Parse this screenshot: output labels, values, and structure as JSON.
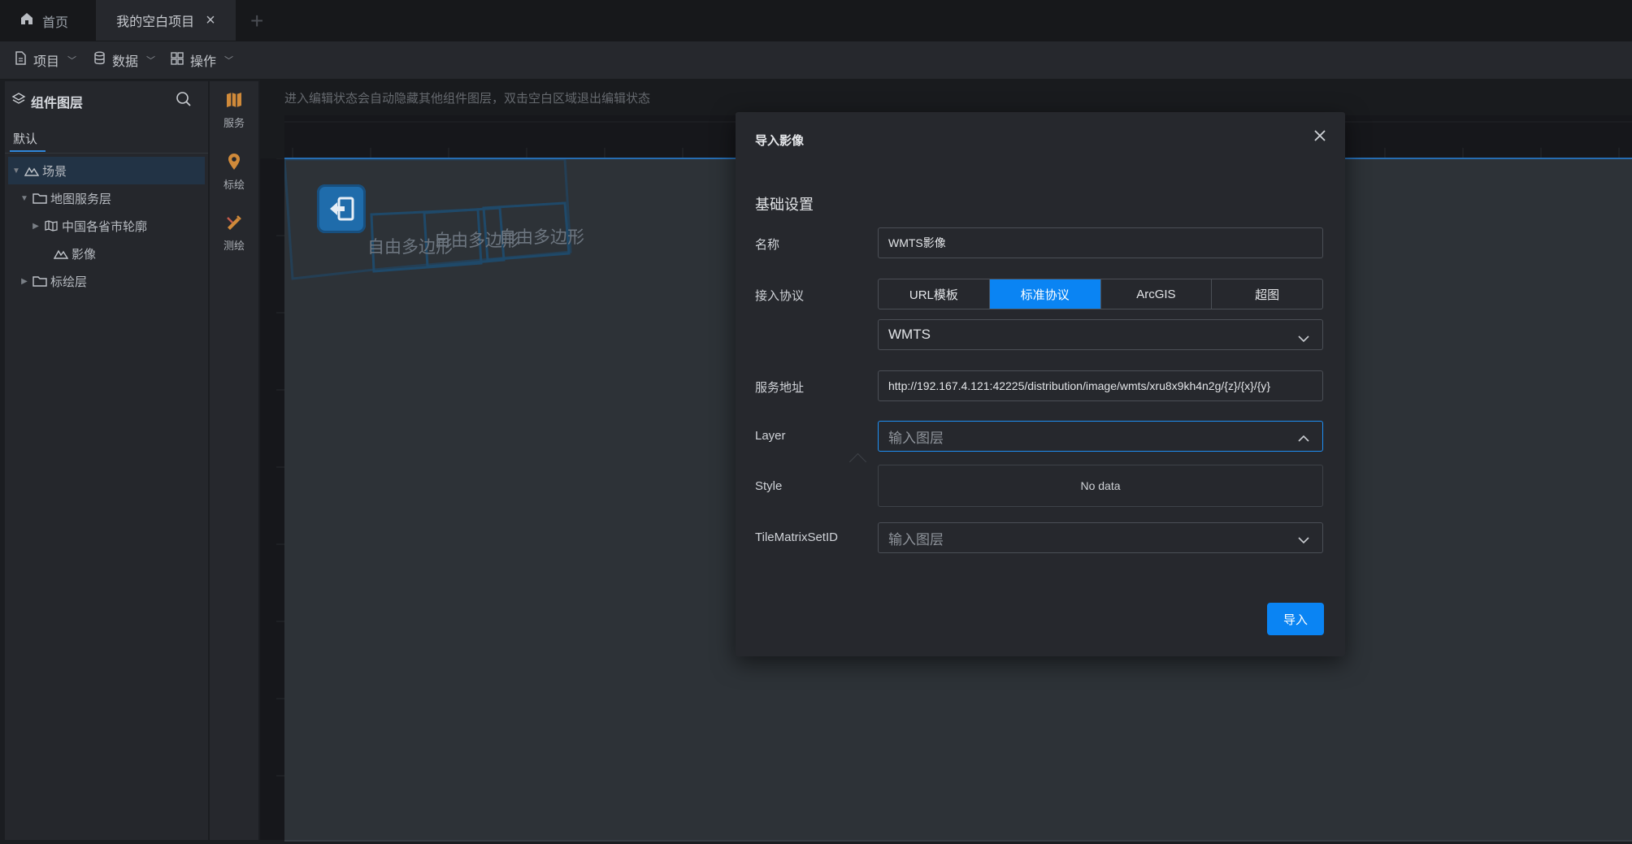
{
  "tabs": {
    "home_label": "首页",
    "project_label": "我的空白项目",
    "add_label": "+"
  },
  "menubar": {
    "project_label": "项目",
    "data_label": "数据",
    "operation_label": "操作"
  },
  "layer_panel": {
    "title": "组件图层",
    "tab_default": "默认",
    "tree": [
      {
        "label": "场景",
        "level": 0,
        "icon": "terrain-icon",
        "expanded": true,
        "selected": true
      },
      {
        "label": "地图服务层",
        "level": 1,
        "icon": "folder-icon",
        "expanded": true
      },
      {
        "label": "中国各省市轮廓",
        "level": 2,
        "icon": "map-icon",
        "expanded": false
      },
      {
        "label": "影像",
        "level": 2,
        "icon": "terrain-icon"
      },
      {
        "label": "标绘层",
        "level": 1,
        "icon": "folder-icon",
        "expanded": false
      }
    ]
  },
  "toolstrip": {
    "service_label": "服务",
    "plot_label": "标绘",
    "measure_label": "测绘"
  },
  "canvas": {
    "hint": "进入编辑状态会自动隐藏其他组件图层，双击空白区域退出编辑状态",
    "polygon_labels": [
      "自由多边形",
      "自由多边形",
      "自由多边形"
    ]
  },
  "modal": {
    "title": "导入影像",
    "section": "基础设置",
    "name_label": "名称",
    "name_value": "WMTS影像",
    "protocol_label": "接入协议",
    "protocol_options": [
      "URL模板",
      "标准协议",
      "ArcGIS",
      "超图"
    ],
    "protocol_selected": "标准协议",
    "service_type_value": "WMTS",
    "url_label": "服务地址",
    "url_value": "http://192.167.4.121:42225/distribution/image/wmts/xru8x9kh4n2g/{z}/{x}/{y}",
    "layer_label": "Layer",
    "layer_placeholder": "输入图层",
    "style_label": "Style",
    "dropdown_empty": "No data",
    "tms_label": "TileMatrixSetID",
    "tms_placeholder": "输入图层",
    "import_button": "导入"
  },
  "colors": {
    "accent": "#0a84f3",
    "background": "#1b1d21",
    "panel": "#26282d",
    "canvas": "#373d44"
  }
}
